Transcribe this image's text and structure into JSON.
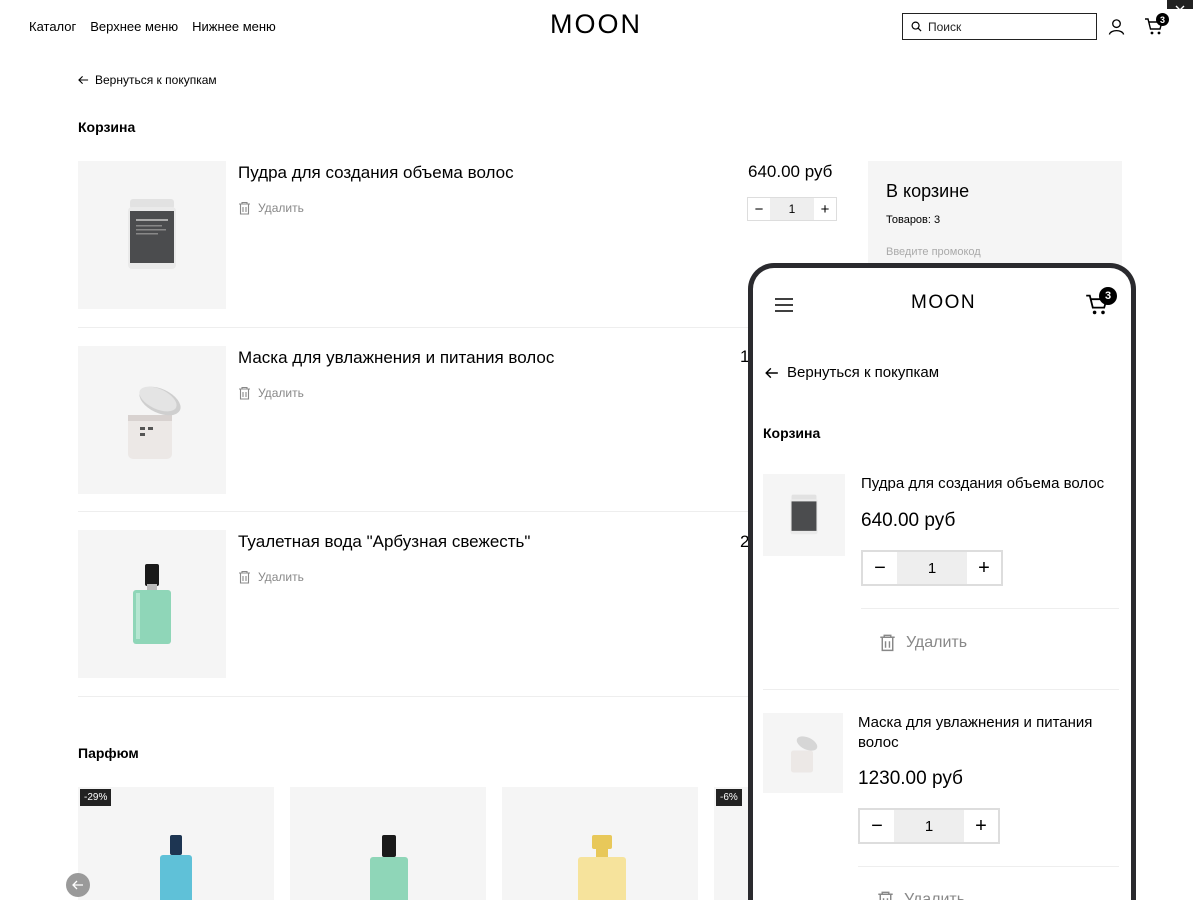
{
  "header": {
    "nav": [
      "Каталог",
      "Верхнее меню",
      "Нижнее меню"
    ],
    "logo": "MOON",
    "search_placeholder": "Поиск",
    "cart_count": "3"
  },
  "back_label": "Вернуться к покупкам",
  "page_title": "Корзина",
  "cart": {
    "items": [
      {
        "name": "Пудра для создания объема волос",
        "price": "640.00 руб",
        "qty": "1",
        "delete_label": "Удалить"
      },
      {
        "name": "Маска для увлажнения и питания волос",
        "price_partial": "1",
        "delete_label": "Удалить"
      },
      {
        "name": "Туалетная вода \"Арбузная свежесть\"",
        "price_partial": "2",
        "delete_label": "Удалить"
      }
    ]
  },
  "summary": {
    "title": "В корзине",
    "count_label": "Товаров: 3",
    "promo_placeholder": "Введите промокод"
  },
  "perfume": {
    "title": "Парфюм",
    "badges": [
      "-29%",
      "-6%"
    ]
  },
  "mobile": {
    "logo": "MOON",
    "cart_count": "3",
    "back_label": "Вернуться к покупкам",
    "title": "Корзина",
    "items": [
      {
        "name": "Пудра для создания объема волос",
        "price": "640.00 руб",
        "qty": "1",
        "delete_label": "Удалить"
      },
      {
        "name": "Маска для увлажнения и питания волос",
        "price": "1230.00 руб",
        "qty": "1",
        "delete_label": "Удалить"
      }
    ]
  },
  "colors": {
    "accent": "#000000",
    "muted": "#888888",
    "panel": "#f5f5f5",
    "phone_frame": "#2a2a2e"
  }
}
